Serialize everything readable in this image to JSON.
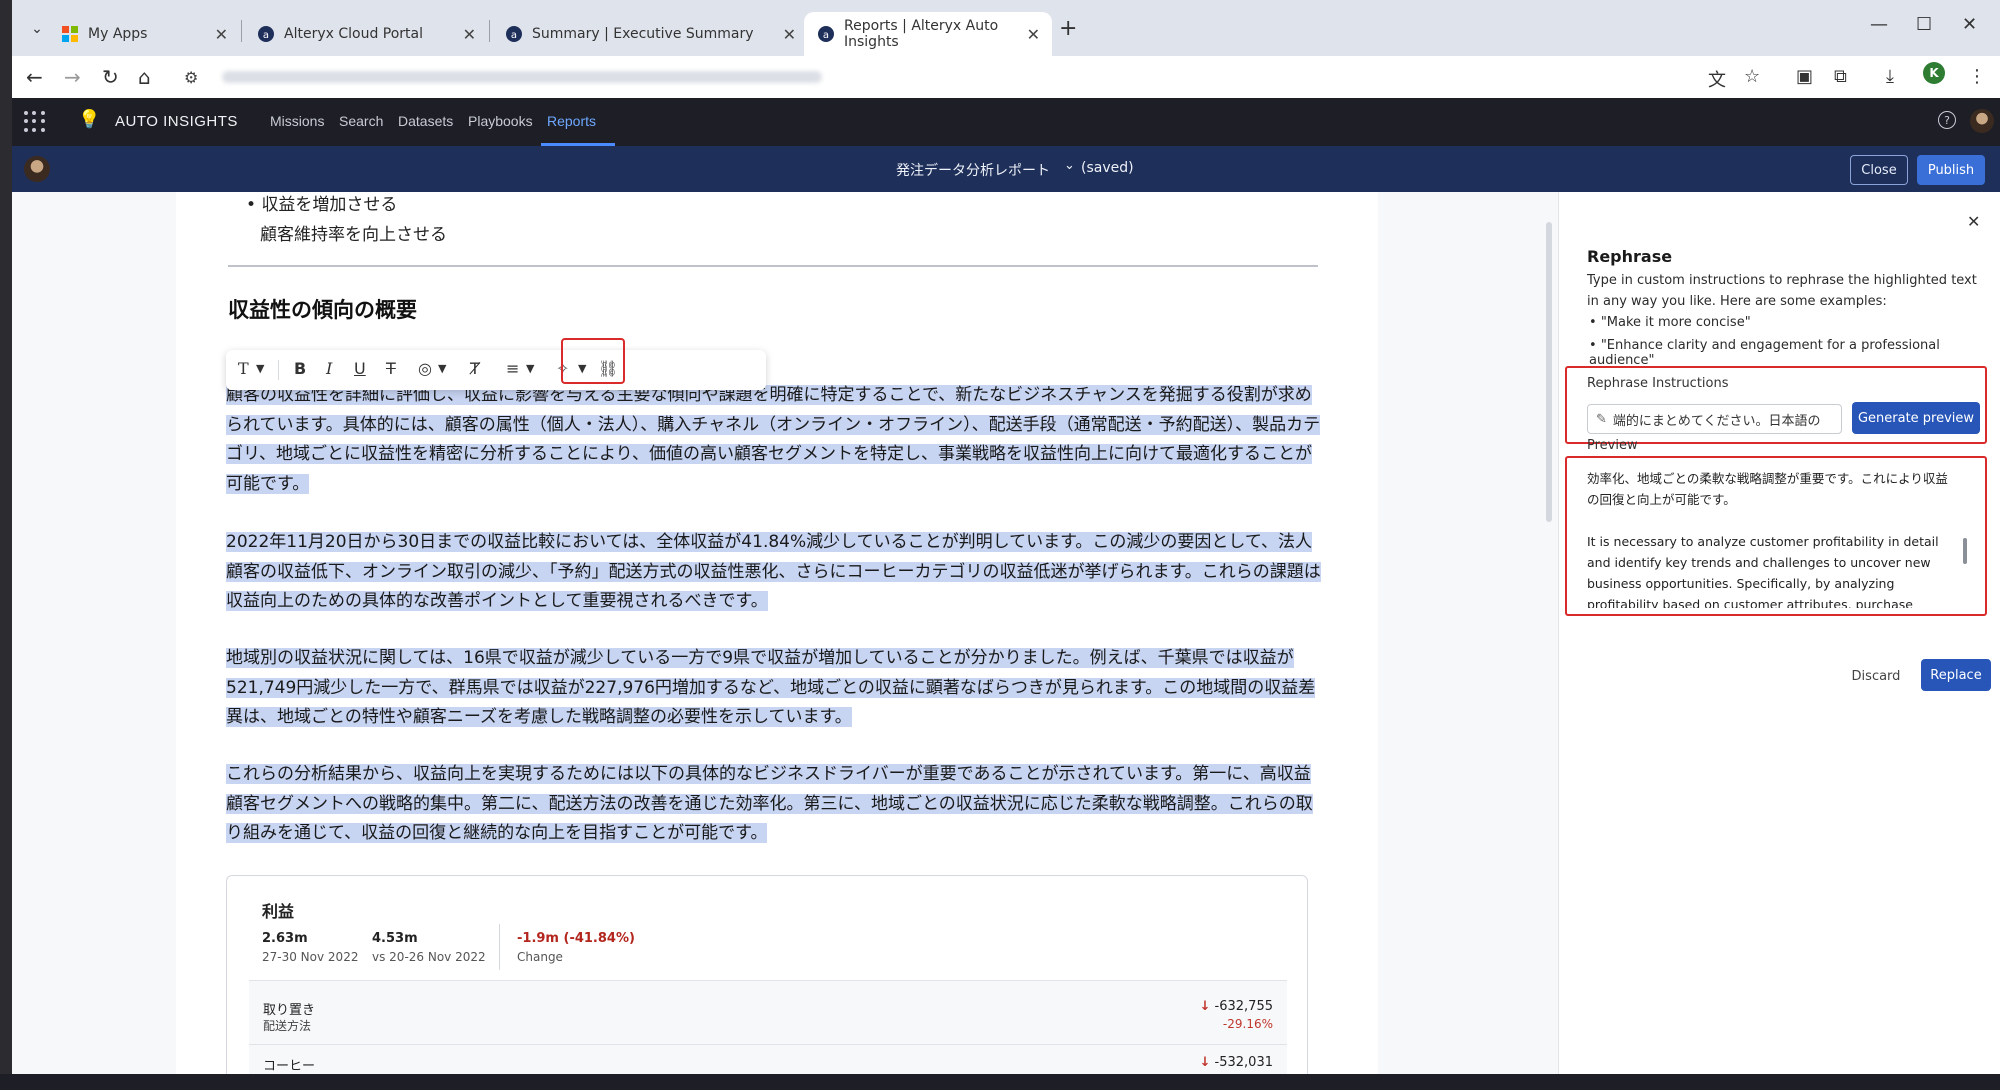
{
  "browser": {
    "tabs": [
      {
        "title": "My Apps",
        "favicon": "windows-icon"
      },
      {
        "title": "Alteryx Cloud Portal",
        "favicon": "alteryx-icon"
      },
      {
        "title": "Summary | Executive Summary",
        "favicon": "alteryx-icon"
      },
      {
        "title": "Reports | Alteryx Auto Insights",
        "favicon": "alteryx-icon",
        "active": true
      }
    ],
    "profile_initial": "K"
  },
  "app": {
    "brand": "AUTO INSIGHTS",
    "nav": [
      "Missions",
      "Search",
      "Datasets",
      "Playbooks",
      "Reports"
    ],
    "active_nav": "Reports",
    "accent": "#4a8bff"
  },
  "report_bar": {
    "title": "発注データ分析レポート",
    "status": "(saved)",
    "close_label": "Close",
    "publish_label": "Publish"
  },
  "document": {
    "bullets": [
      "収益を増加させる",
      "顧客維持率を向上させる"
    ],
    "heading": "収益性の傾向の概要",
    "paragraphs": [
      "顧客の収益性を詳細に評価し、収益に影響を与える主要な傾向や課題を明確に特定することで、新たなビジネスチャンスを発掘する役割が求められています。具体的には、顧客の属性（個人・法人）、購入チャネル（オンライン・オフライン）、配送手段（通常配送・予約配送）、製品カテゴリ、地域ごとに収益性を精密に分析することにより、価値の高い顧客セグメントを特定し、事業戦略を収益性向上に向けて最適化することが可能です。",
      "2022年11月20日から30日までの収益比較においては、全体収益が41.84%減少していることが判明しています。この減少の要因として、法人顧客の収益低下、オンライン取引の減少、「予約」配送方式の収益性悪化、さらにコーヒーカテゴリの収益低迷が挙げられます。これらの課題は収益向上のための具体的な改善ポイントとして重要視されるべきです。",
      "地域別の収益状況に関しては、16県で収益が減少している一方で9県で収益が増加していることが分かりました。例えば、千葉県では収益が521,749円減少した一方で、群馬県では収益が227,976円増加するなど、地域ごとの収益に顕著なばらつきが見られます。この地域間の収益差異は、地域ごとの特性や顧客ニーズを考慮した戦略調整の必要性を示しています。",
      "これらの分析結果から、収益向上を実現するためには以下の具体的なビジネスドライバーが重要であることが示されています。第一に、高収益顧客セグメントへの戦略的集中。第二に、配送方法の改善を通じた効率化。第三に、地域ごとの収益状況に応じた柔軟な戦略調整。これらの取り組みを通じて、収益の回復と継続的な向上を目指すことが可能です。"
    ],
    "highlight_color": "#c7d4f2",
    "card": {
      "title": "利益",
      "current_value": "2.63m",
      "current_period": "27-30 Nov 2022",
      "prev_value": "4.53m",
      "prev_period": "vs 20-26 Nov 2022",
      "change_value": "-1.9m (-41.84%)",
      "change_label": "Change",
      "rows": [
        {
          "label": "取り置き",
          "sub": "配送方法",
          "value": "-632,755",
          "pct": "-29.16%"
        },
        {
          "label": "コーヒー",
          "sub": "",
          "value": "-532,031",
          "pct": ""
        }
      ]
    }
  },
  "rephrase": {
    "title": "Rephrase",
    "description": "Type in custom instructions to rephrase the highlighted text in any way you like. Here are some examples:",
    "examples": [
      "\"Make it more concise\"",
      "\"Enhance clarity and engagement for a professional audience\""
    ],
    "instructions_label": "Rephrase Instructions",
    "instructions_value": "端的にまとめてください。日本語の",
    "generate_label": "Generate preview",
    "preview_label": "Preview",
    "preview_ja": "効率化、地域ごとの柔軟な戦略調整が重要です。これにより収益の回復と向上が可能です。",
    "preview_en": "It is necessary to analyze customer profitability in detail and identify key trends and challenges to uncover new business opportunities. Specifically, by analyzing profitability based on customer attributes, purchase channels, delivery methods, product categories, and regions, valuable customer segments",
    "discard_label": "Discard",
    "replace_label": "Replace"
  }
}
